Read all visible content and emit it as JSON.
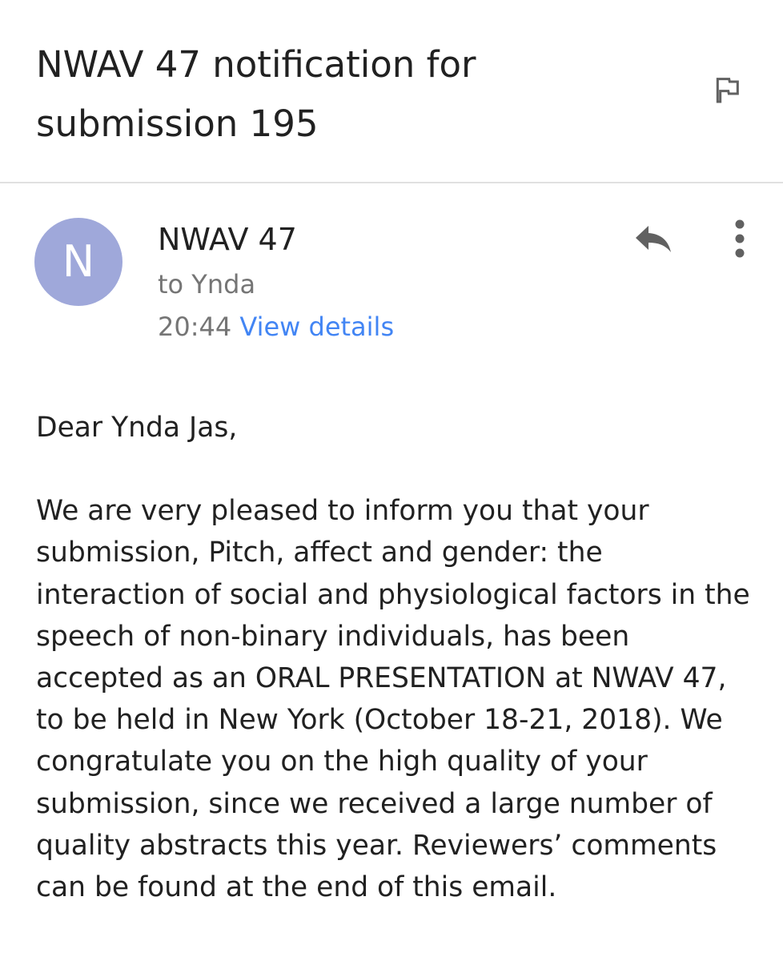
{
  "subject": {
    "title": "NWAV 47 notification for submission 195"
  },
  "sender": {
    "avatar_letter": "N",
    "avatar_color": "#9fa8da",
    "name": "NWAV 47",
    "recipient": "to Ynda",
    "time": "20:44",
    "view_details_label": "View details",
    "link_color": "#4285f4"
  },
  "icons": {
    "flag": "flag-icon",
    "reply": "reply-icon",
    "more": "more-vert-icon"
  },
  "body": {
    "greeting": "Dear Ynda Jas,",
    "paragraph": "We are very pleased to inform you that your submission, Pitch, affect and gender: the interaction of social and physiological factors in the speech of non-binary individuals, has been accepted as an ORAL PRESENTATION at NWAV 47, to be held in New York (October 18-21, 2018). We congratulate you on the high quality of your submission, since we received a large number of quality abstracts this year. Reviewers’ comments can be found at the end of this email."
  }
}
